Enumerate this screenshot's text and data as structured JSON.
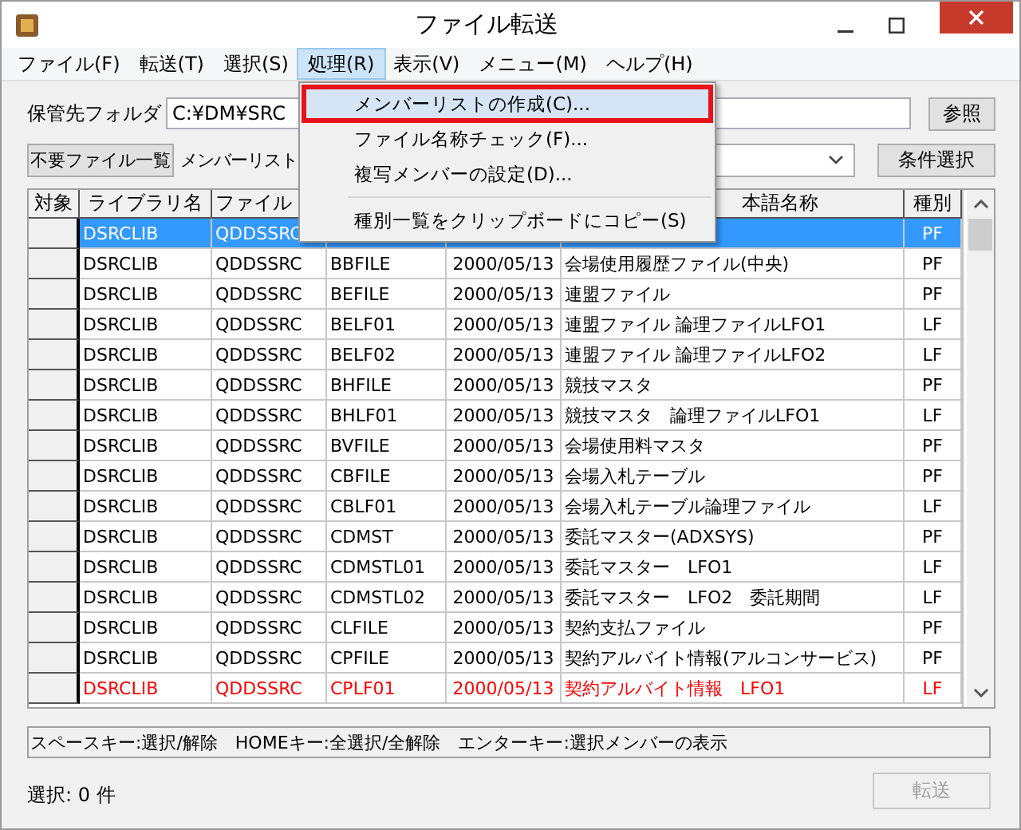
{
  "window": {
    "title": "ファイル転送"
  },
  "menu_bar": [
    {
      "label": "ファイル(F)",
      "selected": false
    },
    {
      "label": "転送(T)",
      "selected": false
    },
    {
      "label": "選択(S)",
      "selected": false
    },
    {
      "label": "処理(R)",
      "selected": true
    },
    {
      "label": "表示(V)",
      "selected": false
    },
    {
      "label": "メニュー(M)",
      "selected": false
    },
    {
      "label": "ヘルプ(H)",
      "selected": false
    }
  ],
  "folder": {
    "label": "保管先フォルダ",
    "value": "C:¥DM¥SRC",
    "browse_button": "参照"
  },
  "filter": {
    "unneeded_button": "不要ファイル一覧",
    "member_list_label": "メンバーリスト",
    "condition_button": "条件選択"
  },
  "dropdown_menu": [
    {
      "kind": "item",
      "label": "メンバーリストの作成(C)...",
      "selected": true
    },
    {
      "kind": "item",
      "label": "ファイル名称チェック(F)...",
      "selected": false
    },
    {
      "kind": "item",
      "label": "複写メンバーの設定(D)...",
      "selected": false
    },
    {
      "kind": "separator"
    },
    {
      "kind": "item",
      "label": "種別一覧をクリップボードにコピー(S)",
      "selected": false
    }
  ],
  "table": {
    "header": {
      "target": "対象",
      "library": "ライブラリ名",
      "file": "ファイル",
      "name": "本語名称",
      "type": "種別"
    },
    "rows": [
      {
        "library": "DSRCLIB",
        "file": "QDDSSRC",
        "type": "PF",
        "selected": true,
        "flagged": false
      },
      {
        "library": "DSRCLIB",
        "file": "QDDSSRC",
        "member": "BBFILE",
        "date": "2000/05/13",
        "name": "会場使用履歴ファイル(中央)",
        "type": "PF",
        "selected": false,
        "flagged": false
      },
      {
        "library": "DSRCLIB",
        "file": "QDDSSRC",
        "member": "BEFILE",
        "date": "2000/05/13",
        "name": "連盟ファイル",
        "type": "PF",
        "selected": false,
        "flagged": false
      },
      {
        "library": "DSRCLIB",
        "file": "QDDSSRC",
        "member": "BELF01",
        "date": "2000/05/13",
        "name": "連盟ファイル 論理ファイルLFO1",
        "type": "LF",
        "selected": false,
        "flagged": false
      },
      {
        "library": "DSRCLIB",
        "file": "QDDSSRC",
        "member": "BELF02",
        "date": "2000/05/13",
        "name": "連盟ファイル 論理ファイルLFO2",
        "type": "LF",
        "selected": false,
        "flagged": false
      },
      {
        "library": "DSRCLIB",
        "file": "QDDSSRC",
        "member": "BHFILE",
        "date": "2000/05/13",
        "name": "競技マスタ",
        "type": "PF",
        "selected": false,
        "flagged": false
      },
      {
        "library": "DSRCLIB",
        "file": "QDDSSRC",
        "member": "BHLF01",
        "date": "2000/05/13",
        "name": "競技マスタ　論理ファイルLFO1",
        "type": "LF",
        "selected": false,
        "flagged": false
      },
      {
        "library": "DSRCLIB",
        "file": "QDDSSRC",
        "member": "BVFILE",
        "date": "2000/05/13",
        "name": "会場使用料マスタ",
        "type": "PF",
        "selected": false,
        "flagged": false
      },
      {
        "library": "DSRCLIB",
        "file": "QDDSSRC",
        "member": "CBFILE",
        "date": "2000/05/13",
        "name": "会場入札テーブル",
        "type": "PF",
        "selected": false,
        "flagged": false
      },
      {
        "library": "DSRCLIB",
        "file": "QDDSSRC",
        "member": "CBLF01",
        "date": "2000/05/13",
        "name": "会場入札テーブル論理ファイル",
        "type": "LF",
        "selected": false,
        "flagged": false
      },
      {
        "library": "DSRCLIB",
        "file": "QDDSSRC",
        "member": "CDMST",
        "date": "2000/05/13",
        "name": "委託マスター(ADXSYS)",
        "type": "PF",
        "selected": false,
        "flagged": false
      },
      {
        "library": "DSRCLIB",
        "file": "QDDSSRC",
        "member": "CDMSTL01",
        "date": "2000/05/13",
        "name": "委託マスター　LFO1",
        "type": "LF",
        "selected": false,
        "flagged": false
      },
      {
        "library": "DSRCLIB",
        "file": "QDDSSRC",
        "member": "CDMSTL02",
        "date": "2000/05/13",
        "name": "委託マスター　LFO2　委託期間",
        "type": "LF",
        "selected": false,
        "flagged": false
      },
      {
        "library": "DSRCLIB",
        "file": "QDDSSRC",
        "member": "CLFILE",
        "date": "2000/05/13",
        "name": "契約支払ファイル",
        "type": "PF",
        "selected": false,
        "flagged": false
      },
      {
        "library": "DSRCLIB",
        "file": "QDDSSRC",
        "member": "CPFILE",
        "date": "2000/05/13",
        "name": "契約アルバイト情報(アルコンサービス)",
        "type": "PF",
        "selected": false,
        "flagged": false
      },
      {
        "library": "DSRCLIB",
        "file": "QDDSSRC",
        "member": "CPLF01",
        "date": "2000/05/13",
        "name": "契約アルバイト情報　LFO1",
        "type": "LF",
        "selected": false,
        "flagged": true
      }
    ]
  },
  "hint_bar": "スペースキー:選択/解除　HOMEキー:全選択/全解除　エンターキー:選択メンバーの表示",
  "status": "選択: 0 件",
  "transfer_button": {
    "label": "転送",
    "disabled": true
  }
}
